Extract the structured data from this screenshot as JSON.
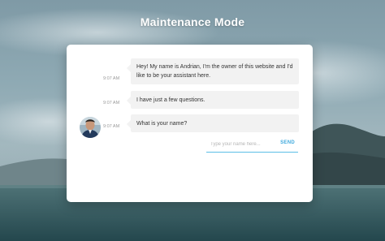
{
  "page": {
    "title": "Maintenance Mode"
  },
  "chat": {
    "messages": [
      {
        "time": "9:07 AM",
        "text": "Hey! My name is Andrian, I'm the owner of this website and I'd like to be your assistant here."
      },
      {
        "time": "9:07 AM",
        "text": "I have just a few questions."
      },
      {
        "time": "9:07 AM",
        "text": "What is your name?"
      }
    ],
    "input": {
      "placeholder": "Type your name here...",
      "value": ""
    },
    "send_label": "SEND"
  },
  "colors": {
    "accent": "#3fa9dd",
    "bubble": "#f2f2f2",
    "card": "#ffffff"
  }
}
